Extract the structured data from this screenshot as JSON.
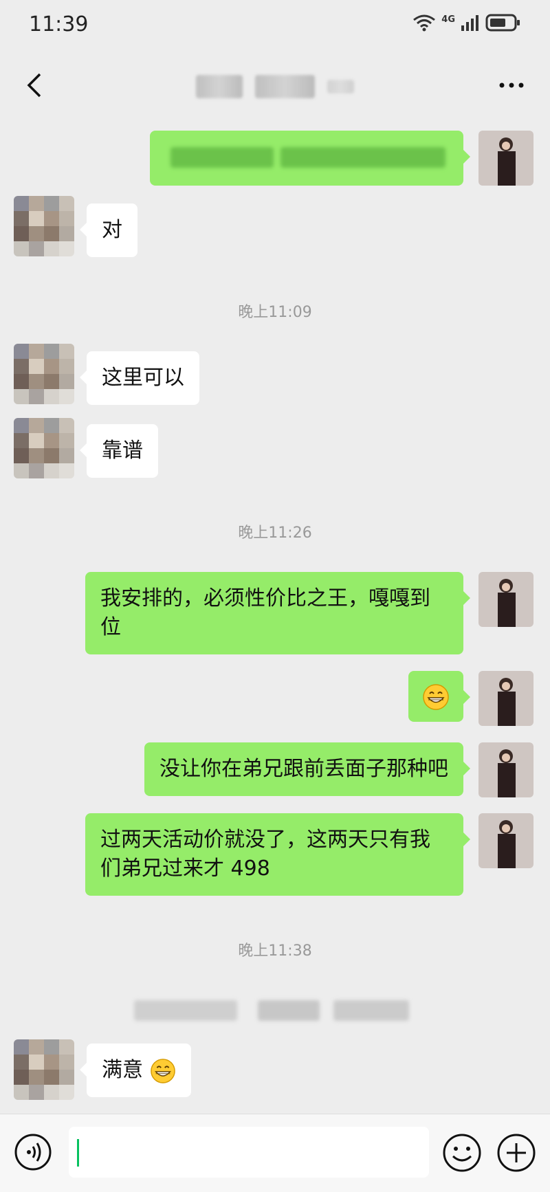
{
  "status_bar": {
    "time": "11:39",
    "network": "4G"
  },
  "chat": {
    "messages": [
      {
        "side": "out",
        "text": ""
      },
      {
        "side": "in",
        "text": "对"
      },
      {
        "type": "time",
        "text": "晚上11:09"
      },
      {
        "side": "in",
        "text": "这里可以"
      },
      {
        "side": "in",
        "text": "靠谱"
      },
      {
        "type": "time",
        "text": "晚上11:26"
      },
      {
        "side": "out",
        "text": "我安排的，必须性价比之王，嘎嘎到位"
      },
      {
        "side": "out",
        "text": "",
        "emoji": "grinning-emoji"
      },
      {
        "side": "out",
        "text": "没让你在弟兄跟前丢面子那种吧"
      },
      {
        "side": "out",
        "text": "过两天活动价就没了，这两天只有我们弟兄过来才 498"
      },
      {
        "type": "time",
        "text": "晚上11:38"
      },
      {
        "side": "in",
        "text": "满意",
        "emoji": "grinning-emoji"
      }
    ]
  },
  "colors": {
    "background": "#ededed",
    "outgoing": "#95ec69",
    "incoming": "#ffffff",
    "accent": "#07c160"
  },
  "icons": [
    "back-icon",
    "more-icon",
    "wifi-icon",
    "signal-icon",
    "battery-icon",
    "voice-icon",
    "emoji-icon",
    "plus-icon"
  ]
}
